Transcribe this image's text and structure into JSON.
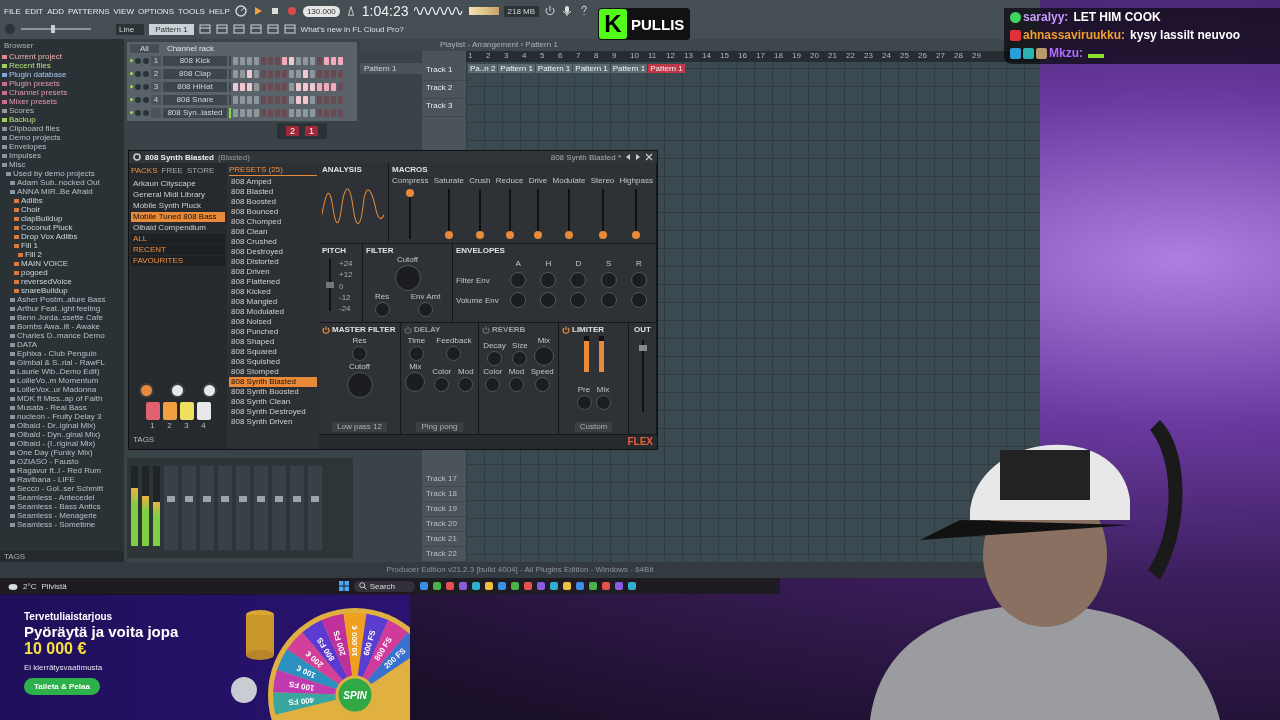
{
  "daw": {
    "menu": [
      "FILE",
      "EDIT",
      "ADD",
      "PATTERNS",
      "VIEW",
      "OPTIONS",
      "TOOLS",
      "HELP"
    ],
    "tempo": "130.000",
    "time": "1:04:23",
    "memory": "218 MB",
    "master_pitch": {
      "level": 0.45
    },
    "pattern": "Pattern 1",
    "snap": "Line",
    "news": "What's new in FL Cloud Pro?",
    "browser": {
      "title": "Browser",
      "tags": "TAGS",
      "items": [
        {
          "label": "Current project",
          "kind": "project"
        },
        {
          "label": "Recent files",
          "kind": "recent"
        },
        {
          "label": "Plugin database",
          "kind": "database"
        },
        {
          "label": "Plugin presets",
          "kind": "presets"
        },
        {
          "label": "Channel presets",
          "kind": "presets"
        },
        {
          "label": "Mixer presets",
          "kind": "presets"
        },
        {
          "label": "Scores",
          "kind": "scores"
        },
        {
          "label": "Backup",
          "kind": "recent"
        },
        {
          "label": "Clipboard files",
          "kind": "folder"
        },
        {
          "label": "Demo projects",
          "kind": "folder"
        },
        {
          "label": "Envelopes",
          "kind": "folder"
        },
        {
          "label": "Impulses",
          "kind": "folder"
        },
        {
          "label": "Misc",
          "kind": "folder",
          "children": [
            {
              "label": "Used by demo projects",
              "kind": "folder",
              "children": [
                {
                  "label": "Adam Sub..nocked Out",
                  "kind": "folder"
                },
                {
                  "label": "ANNA MIR..Be Afraid",
                  "kind": "folder",
                  "children": [
                    {
                      "label": "Adlibs",
                      "kind": "file"
                    },
                    {
                      "label": "Choir",
                      "kind": "file"
                    },
                    {
                      "label": "clapBuildup",
                      "kind": "file"
                    },
                    {
                      "label": "Coconut Pluck",
                      "kind": "file"
                    },
                    {
                      "label": "Drop Vox Adlibs",
                      "kind": "file"
                    },
                    {
                      "label": "Fill 1",
                      "kind": "file",
                      "children": [
                        {
                          "label": "Fill 2",
                          "kind": "file"
                        }
                      ]
                    },
                    {
                      "label": "MAIN VOICE",
                      "kind": "file"
                    },
                    {
                      "label": "pogoed",
                      "kind": "file"
                    },
                    {
                      "label": "reversedVoice",
                      "kind": "file"
                    },
                    {
                      "label": "snareBuildup",
                      "kind": "file"
                    }
                  ]
                },
                {
                  "label": "Asher Postm..ature Bass",
                  "kind": "folder"
                },
                {
                  "label": "Arthur Feat..ight feeling",
                  "kind": "folder"
                },
                {
                  "label": "Benn Jorda..ssette Cafe",
                  "kind": "folder"
                },
                {
                  "label": "Bombs Awa..ilt - Awake",
                  "kind": "folder"
                },
                {
                  "label": "Charles D..mance Demo",
                  "kind": "folder"
                },
                {
                  "label": "DATA",
                  "kind": "folder"
                },
                {
                  "label": "Ephixa - Club Penguin",
                  "kind": "folder"
                },
                {
                  "label": "Gimbal & S..rial - RawFL",
                  "kind": "folder"
                },
                {
                  "label": "Laurie Wib..Demo Edit)",
                  "kind": "folder"
                },
                {
                  "label": "LollieVo..m Momentum",
                  "kind": "folder"
                },
                {
                  "label": "LollieVox..ur Madonna",
                  "kind": "folder"
                },
                {
                  "label": "MDK ft Miss..ap of Faith",
                  "kind": "folder"
                },
                {
                  "label": "Musata - Real Bass",
                  "kind": "folder"
                },
                {
                  "label": "nucleon - Fruity Delay 3",
                  "kind": "folder"
                },
                {
                  "label": "Olbaid - Dr..iginal Mix)",
                  "kind": "folder"
                },
                {
                  "label": "Olbaid - Dyn..ginal Mix)",
                  "kind": "folder"
                },
                {
                  "label": "Olbaid - (I..riginal Mix)",
                  "kind": "folder"
                },
                {
                  "label": "One Day (Funky Mix)",
                  "kind": "folder"
                },
                {
                  "label": "OZIASO - Fausto",
                  "kind": "folder"
                },
                {
                  "label": "Ragavur ft..l - Red Rum",
                  "kind": "folder"
                },
                {
                  "label": "Ravibana - LIFE",
                  "kind": "folder"
                },
                {
                  "label": "Secco - Gol..ser Schmitt",
                  "kind": "folder"
                },
                {
                  "label": "Seamless - Antecedel",
                  "kind": "folder"
                },
                {
                  "label": "Seamless - Bass Antics",
                  "kind": "folder"
                },
                {
                  "label": "Seamless - Menagerie",
                  "kind": "folder"
                },
                {
                  "label": "Seamless - Sometime",
                  "kind": "folder"
                }
              ]
            }
          ]
        }
      ]
    },
    "channel_rack": {
      "title": "Channel rack",
      "filter": "All",
      "channels": [
        {
          "number": "1",
          "name": "808 Kick",
          "selected": false,
          "steps": [
            false,
            false,
            false,
            false,
            false,
            false,
            false,
            true,
            true,
            false,
            false,
            false,
            false,
            true,
            true,
            true
          ]
        },
        {
          "number": "2",
          "name": "808 Clap",
          "selected": false,
          "steps": [
            false,
            false,
            true,
            false,
            false,
            false,
            false,
            false,
            false,
            false,
            true,
            false,
            false,
            false,
            false,
            false
          ]
        },
        {
          "number": "3",
          "name": "808 HiHat",
          "selected": false,
          "steps": [
            true,
            true,
            true,
            false,
            false,
            false,
            false,
            false,
            false,
            true,
            true,
            true,
            true,
            true,
            true,
            false
          ]
        },
        {
          "number": "4",
          "name": "808 Snare",
          "selected": false,
          "steps": [
            false,
            false,
            false,
            false,
            false,
            false,
            false,
            false,
            false,
            true,
            true,
            false,
            false,
            false,
            false,
            false
          ]
        },
        {
          "name": "808 Syn..lasted",
          "selected": true,
          "steps": [
            false,
            false,
            false,
            false,
            false,
            false,
            false,
            false,
            false,
            false,
            false,
            false,
            false,
            false,
            false,
            false
          ]
        }
      ]
    },
    "mini_display": [
      "2",
      "1"
    ],
    "mixer": {
      "meters": [
        {
          "level": 0.72
        },
        {
          "level": 0.62
        },
        {
          "level": 0.55
        }
      ]
    },
    "playlist": {
      "title": "Playlist - Arrangement › Pattern 1",
      "patterns": [
        "Pattern 1"
      ],
      "bars": [
        "1",
        "2",
        "3",
        "4",
        "5",
        "6",
        "7",
        "8",
        "9",
        "10",
        "11",
        "12",
        "13",
        "14",
        "15",
        "16",
        "17",
        "18",
        "19",
        "20",
        "21",
        "22",
        "23",
        "24",
        "25",
        "26",
        "27",
        "28",
        "29"
      ],
      "tracks_top": [
        "Track 1",
        "Track 2",
        "Track 3"
      ],
      "tracks_bottom": [
        "Track 17",
        "Track 18",
        "Track 19",
        "Track 20",
        "Track 21",
        "Track 22"
      ],
      "clips": [
        {
          "label": "Pa..n 2",
          "selected": false
        },
        {
          "label": "Pattern 1",
          "selected": false
        },
        {
          "label": "Pattern 1",
          "selected": false
        },
        {
          "label": "Pattern 1",
          "selected": false
        },
        {
          "label": "Pattern 1",
          "selected": false
        },
        {
          "label": "Pattern 1",
          "selected": true
        }
      ]
    },
    "status": "Producer Edition v21.2.3 [build 4004] - All Plugins Edition - Windows - 64Bit",
    "flex": {
      "title": "808 Synth Blasted",
      "subtitle": "(Blasted)",
      "preset_name": "808 Synth Blasted *",
      "tabs": [
        {
          "label": "PACKS",
          "selected": true
        },
        {
          "label": "FREE",
          "selected": false
        },
        {
          "label": "STORE",
          "selected": false
        }
      ],
      "packs": [
        {
          "label": "Arkaun Cityscape",
          "selected": false
        },
        {
          "label": "General Midi Library",
          "selected": false
        },
        {
          "label": "Mobile Synth Pluck",
          "selected": false
        },
        {
          "label": "Mobile Tuned 808 Bass",
          "selected": true
        },
        {
          "label": "Olbaid Compendium",
          "selected": false
        }
      ],
      "categories": [
        "ALL",
        "RECENT",
        "FAVOURITES"
      ],
      "presets_title": "PRESETS (25)",
      "presets": [
        {
          "label": "808 Amped",
          "selected": false
        },
        {
          "label": "808 Blasted",
          "selected": false
        },
        {
          "label": "808 Boosted",
          "selected": false
        },
        {
          "label": "808 Bounced",
          "selected": false
        },
        {
          "label": "808 Chomped",
          "selected": false
        },
        {
          "label": "808 Clean",
          "selected": false
        },
        {
          "label": "808 Crushed",
          "selected": false
        },
        {
          "label": "808 Destroyed",
          "selected": false
        },
        {
          "label": "808 Distorted",
          "selected": false
        },
        {
          "label": "808 Driven",
          "selected": false
        },
        {
          "label": "808 Flattened",
          "selected": false
        },
        {
          "label": "808 Kicked",
          "selected": false
        },
        {
          "label": "808 Mangled",
          "selected": false
        },
        {
          "label": "808 Modulated",
          "selected": false
        },
        {
          "label": "808 Noised",
          "selected": false
        },
        {
          "label": "808 Punched",
          "selected": false
        },
        {
          "label": "808 Shaped",
          "selected": false
        },
        {
          "label": "808 Squared",
          "selected": false
        },
        {
          "label": "808 Squished",
          "selected": false
        },
        {
          "label": "808 Stomped",
          "selected": false
        },
        {
          "label": "808 Synth Blasted",
          "selected": true
        },
        {
          "label": "808 Synth Boosted",
          "selected": false
        },
        {
          "label": "808 Synth Clean",
          "selected": false
        },
        {
          "label": "808 Synth Destroyed",
          "selected": false
        },
        {
          "label": "808 Synth Driven",
          "selected": false
        }
      ],
      "pads": [
        "1",
        "2",
        "3",
        "4"
      ],
      "tags": "TAGS",
      "analysis_title": "ANALYSIS",
      "macros_title": "MACROS",
      "macros": [
        {
          "label": "Compress",
          "level": 1
        },
        {
          "label": "Saturate",
          "level": 0
        },
        {
          "label": "Crush",
          "level": 0
        },
        {
          "label": "Reduce",
          "level": 0
        },
        {
          "label": "Drive",
          "level": 0
        },
        {
          "label": "Modulate",
          "level": 0
        },
        {
          "label": "Stereo",
          "level": 0
        },
        {
          "label": "Highpass",
          "level": 0
        }
      ],
      "pitch": {
        "title": "PITCH",
        "level": 0.5,
        "scale": [
          "+24",
          "+12",
          "0",
          "-12",
          "-24"
        ]
      },
      "filter": {
        "title": "FILTER",
        "knobs": [
          {
            "label": "Cutoff",
            "kind": "large"
          },
          {
            "label": "Res",
            "kind": "small"
          },
          {
            "label": "Env Amt",
            "kind": "small"
          }
        ]
      },
      "envelopes": {
        "title": "ENVELOPES",
        "columns": [
          "A",
          "H",
          "D",
          "S",
          "R"
        ],
        "rows": [
          "Filter Env",
          "Volume Env"
        ]
      },
      "effects": [
        {
          "title": "MASTER FILTER",
          "enabled": true,
          "knobs": [
            {
              "label": "Res",
              "kind": "small"
            },
            {
              "label": "Cutoff",
              "kind": "large"
            }
          ],
          "dropdown": "Low pass 12"
        },
        {
          "title": "DELAY",
          "enabled": false,
          "knobs": [
            {
              "label": "Time",
              "kind": "small"
            },
            {
              "label": "Feedback",
              "kind": "small"
            },
            {
              "label": "Mix",
              "kind": "medium"
            },
            {
              "label": "Color",
              "kind": "small"
            },
            {
              "label": "Mod",
              "kind": "small"
            }
          ],
          "dropdown": "Ping pong"
        },
        {
          "title": "REVERB",
          "enabled": false,
          "knobs": [
            {
              "label": "Decay",
              "kind": "small"
            },
            {
              "label": "Size",
              "kind": "small"
            },
            {
              "label": "Mix",
              "kind": "medium"
            },
            {
              "label": "Color",
              "kind": "small"
            },
            {
              "label": "Mod",
              "kind": "small"
            },
            {
              "label": "Speed",
              "kind": "small"
            }
          ]
        },
        {
          "title": "LIMITER",
          "enabled": true,
          "meters": [
            {
              "level": 0.85
            },
            {
              "level": 0.85
            }
          ],
          "knobs": [
            {
              "label": "Pre",
              "kind": "small"
            },
            {
              "label": "Mix",
              "kind": "small"
            }
          ],
          "dropdown": "Custom"
        }
      ],
      "out": {
        "title": "OUT",
        "level": 0.92
      },
      "logo": "FLEX"
    }
  },
  "taskbar": {
    "temperature": "2°C",
    "weather": "Pilvistä",
    "search": "Search"
  },
  "streamer": {
    "logo_letter": "K",
    "name": "PULLIS"
  },
  "chat": [
    {
      "user": "saralyy:",
      "color": "#c79cff",
      "text": "LET HIM COOK",
      "badges": [
        {
          "kind": "verified"
        }
      ],
      "kind": "text"
    },
    {
      "user": "ahnassaviruukku:",
      "color": "#f0a030",
      "text": "kysy lassilt neuvoo",
      "badges": [
        {
          "kind": "gift"
        }
      ],
      "kind": "text"
    },
    {
      "user": "Mkzu:",
      "color": "#b070ff",
      "badges": [
        {
          "kind": "hammer"
        },
        {
          "kind": "sub"
        },
        {
          "kind": "crate"
        }
      ],
      "kind": "emote"
    }
  ],
  "ad": {
    "eyebrow": "Tervetuliaistarjous",
    "headline": "Pyöräytä ja voita jopa",
    "amount": "10 000 €",
    "note": "Ei kierrätysvaatimusta",
    "button": "Talleta & Pelaa",
    "wheel_center": "SPIN",
    "wheel_labels": [
      "400 FS",
      "100 FS",
      "100 €",
      "200 €",
      "800 FS",
      "200 FS",
      "10.000 €",
      "600 FS",
      "800 FS",
      "200 FS"
    ]
  }
}
